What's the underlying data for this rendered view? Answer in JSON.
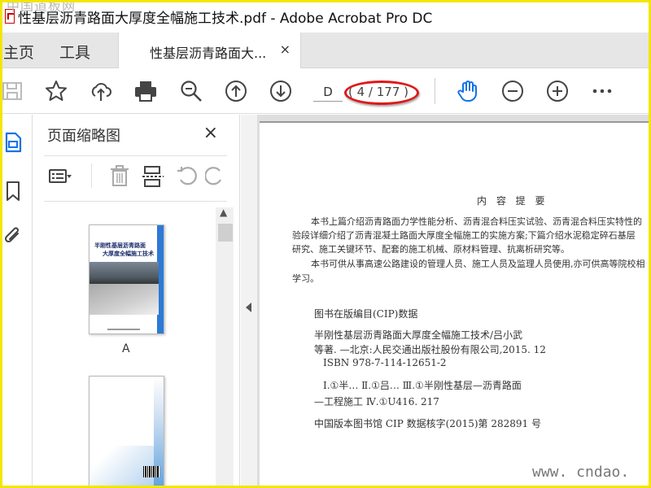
{
  "window": {
    "title": "性基层沥青路面大厚度全幅施工技术.pdf - Adobe Acrobat Pro DC",
    "watermark_top": "中国道板网"
  },
  "tabs": {
    "home": "主页",
    "tools": "工具",
    "document": "性基层沥青路面大...",
    "close": "×"
  },
  "toolbar": {
    "page_input": "D",
    "page_count": "( 4 / 177 )",
    "icons": [
      "save-icon",
      "star-icon",
      "upload-icon",
      "print-icon",
      "zoom-out-search-icon",
      "page-up-icon",
      "page-down-icon",
      "hand-icon",
      "zoom-out-icon",
      "zoom-in-icon",
      "more-icon"
    ],
    "accent_color": "#1473e6",
    "highlight_color": "#e01818"
  },
  "panel": {
    "title": "页面缩略图",
    "close": "×",
    "thumb1_title_line1": "半刚性基层沥青路面",
    "thumb1_title_line2": "大厚度全幅施工技术",
    "thumb1_label": "A"
  },
  "document": {
    "heading": "内 容 提 要",
    "lines": [
      "本书上篇介绍沥青路面力学性能分析、沥青混合料压实试验、沥青混合料压实特性的",
      "验段详细介绍了沥青混凝土路面大厚度全幅施工的实施方案;下篇介绍水泥稳定碎石基层",
      "研究、施工关键环节、配套的施工机械、原材料管理、抗离析研究等。",
      "本书可供从事高速公路建设的管理人员、施工人员及监理人员使用,亦可供高等院校相",
      "学习。"
    ],
    "cip_title": "图书在版编目(CIP)数据",
    "cip_lines": [
      "半刚性基层沥青路面大厚度全幅施工技术/吕小武",
      "等著. —北京:人民交通出版社股份有限公司,2015. 12",
      "ISBN  978-7-114-12651-2",
      "Ⅰ.①半…    Ⅱ.①吕…    Ⅲ.①半刚性基层—沥青路面",
      "—工程施工    Ⅳ.①U416. 217",
      "中国版本图书馆 CIP 数据核字(2015)第 282891 号"
    ],
    "watermark_bottom": "www. cndao. com"
  }
}
